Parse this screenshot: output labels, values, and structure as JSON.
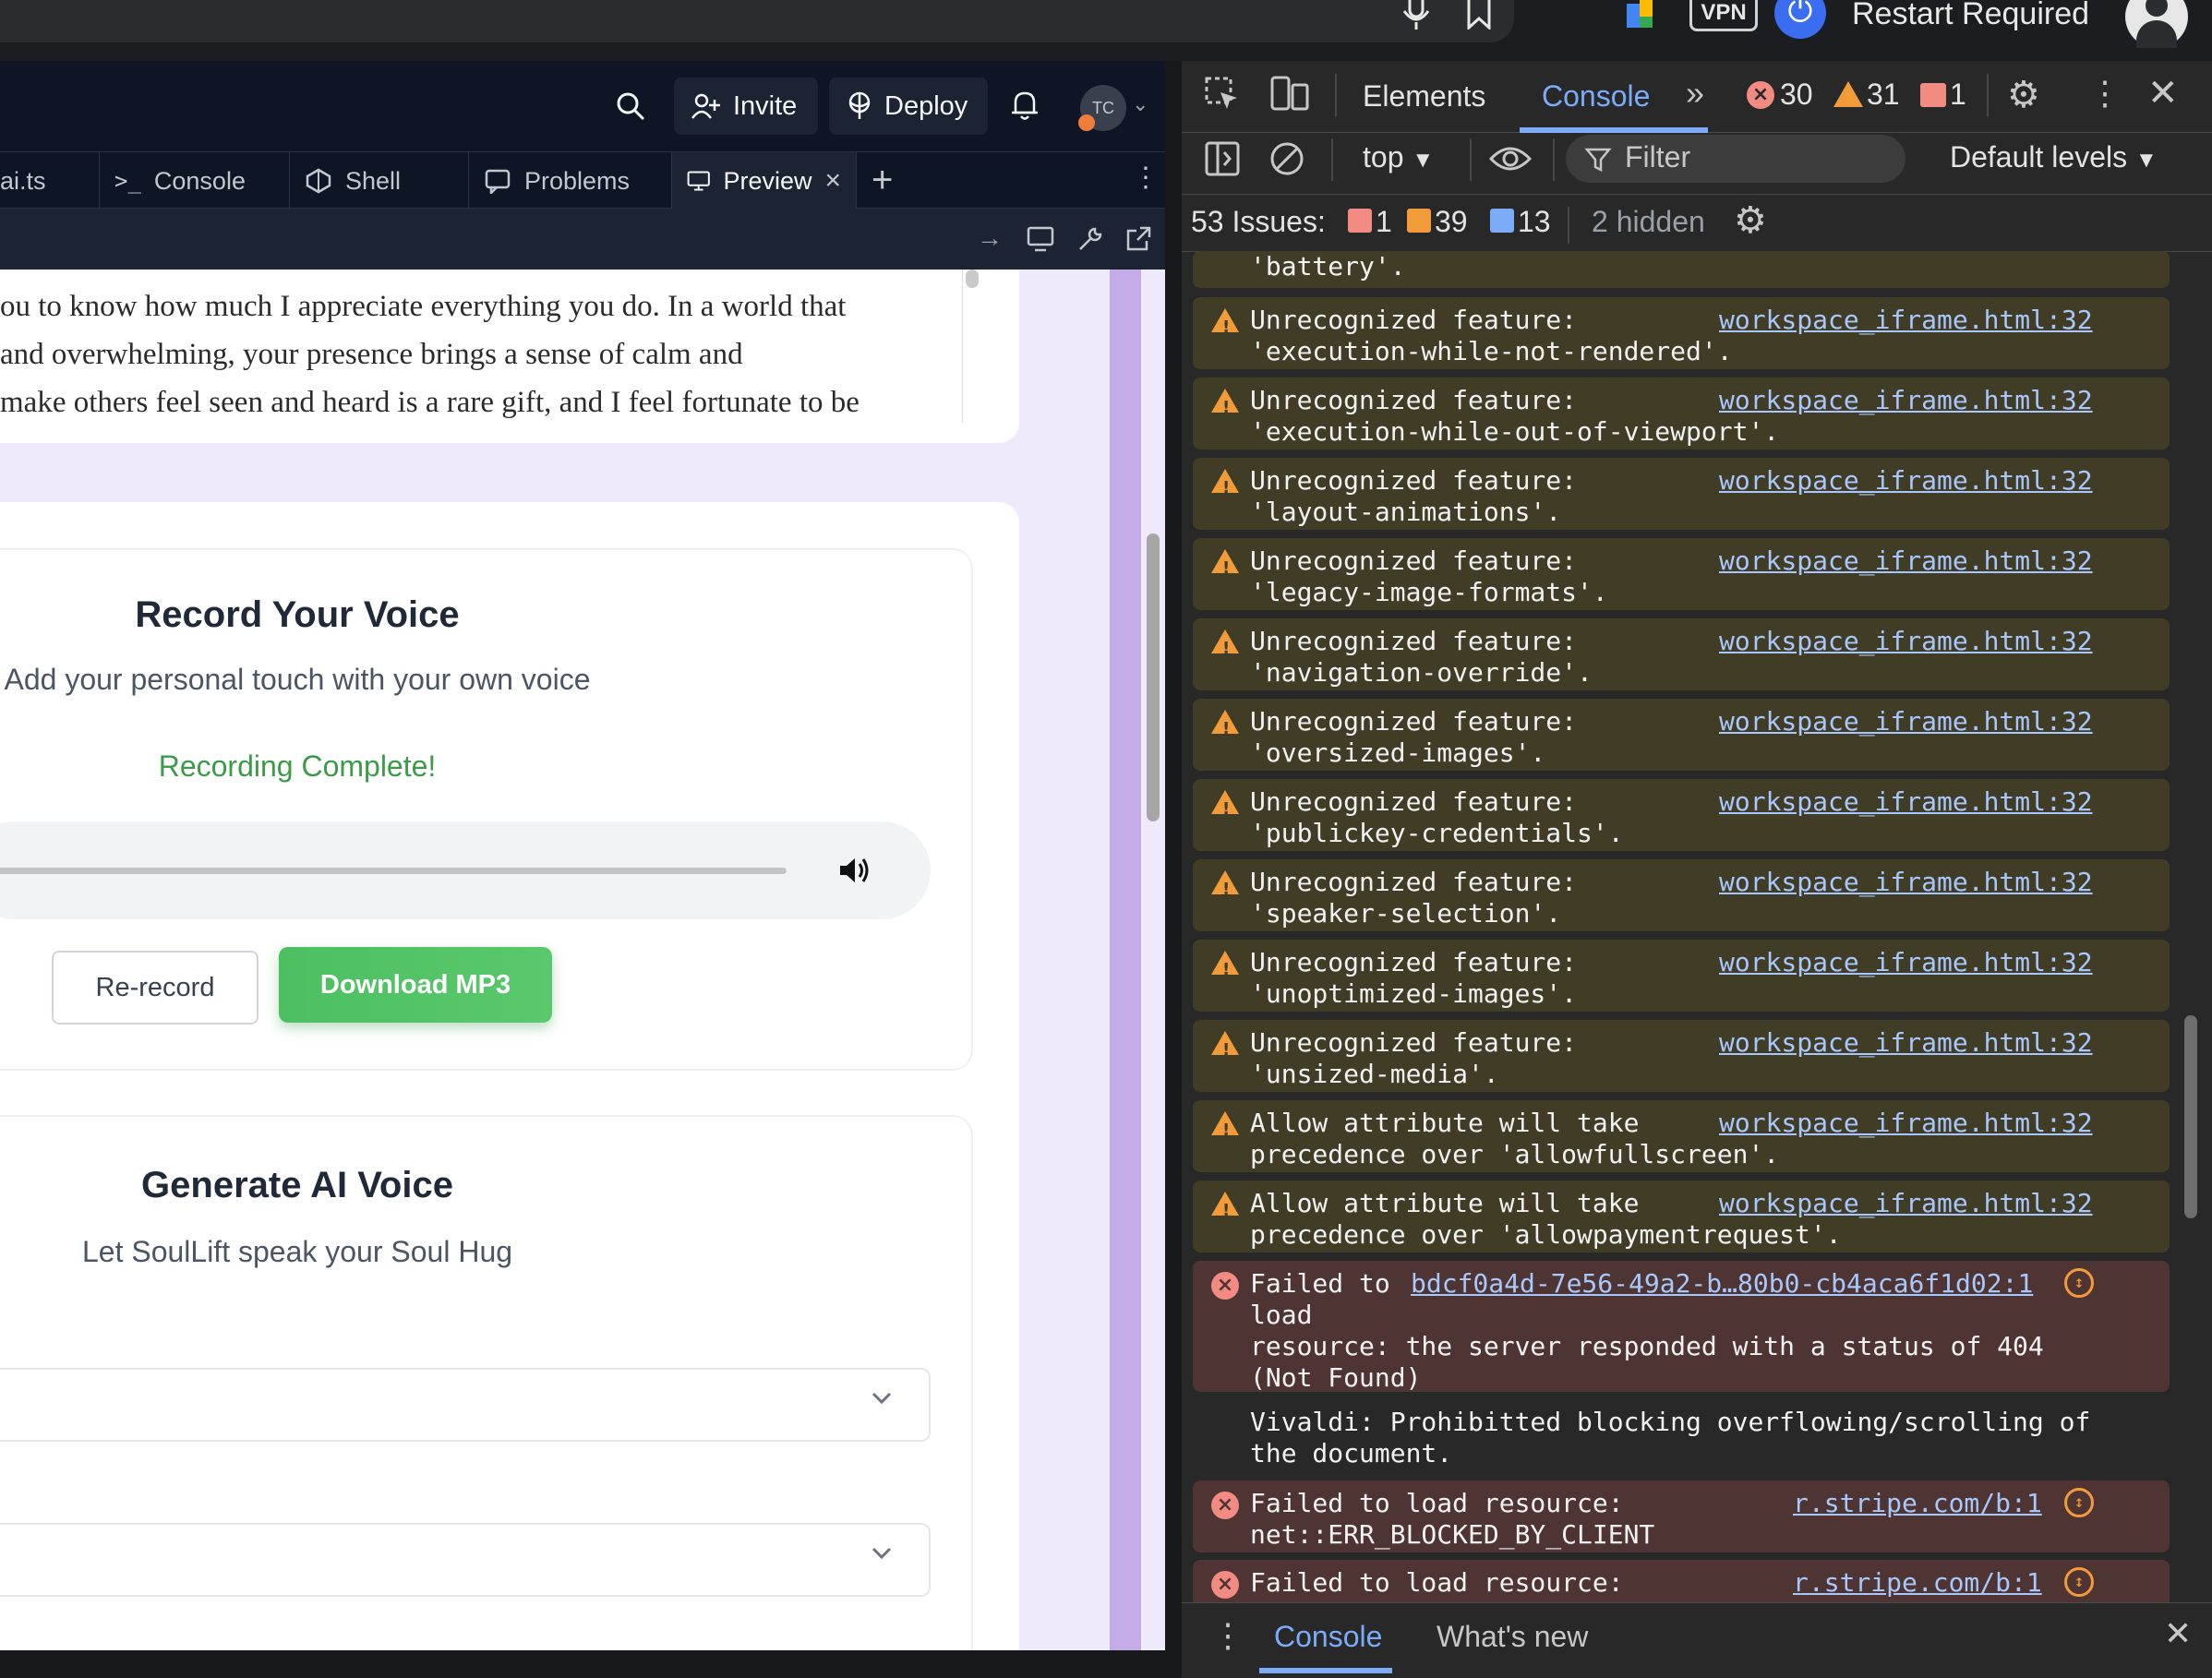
{
  "os": {
    "vpn_label": "VPN",
    "restart_label": "Restart Required"
  },
  "replit": {
    "header": {
      "invite_label": "Invite",
      "deploy_label": "Deploy",
      "avatar_initials": "TC"
    },
    "tabs": [
      {
        "label": "ai.ts"
      },
      {
        "label": "Console"
      },
      {
        "label": "Shell"
      },
      {
        "label": "Problems"
      },
      {
        "label": "Preview"
      }
    ],
    "tab_close": "×",
    "tab_add": "+",
    "preview": {
      "letter_lines": [
        "ou to know how much I appreciate everything you do. In a world that",
        "and overwhelming, your presence brings a sense of calm and",
        "make others feel seen and heard is a rare gift, and I feel fortunate to be"
      ],
      "record": {
        "title": "Record Your Voice",
        "subtitle": "Add your personal touch with your own voice",
        "status": "Recording Complete!",
        "rerecord_label": "Re-record",
        "download_label": "Download MP3"
      },
      "generate": {
        "title": "Generate AI Voice",
        "subtitle": "Let SoulLift speak your Soul Hug"
      }
    }
  },
  "devtools": {
    "tabs": {
      "elements": "Elements",
      "console": "Console"
    },
    "counts": {
      "errors": "30",
      "warnings": "31",
      "issues": "1"
    },
    "toolbar": {
      "context": "top",
      "filter_placeholder": "Filter",
      "levels": "Default levels"
    },
    "issues_bar": {
      "label": "53 Issues:",
      "err": "1",
      "warn": "39",
      "info": "13",
      "hidden": "2 hidden"
    },
    "messages": {
      "m0_line2": "'battery'.",
      "m1_line1": "Unrecognized feature:",
      "m1_line2": "'execution-while-not-rendered'.",
      "m2_line1": "Unrecognized feature:",
      "m2_line2": "'execution-while-out-of-viewport'.",
      "m3_line1": "Unrecognized feature:",
      "m3_line2": "'layout-animations'.",
      "m4_line1": "Unrecognized feature:",
      "m4_line2": "'legacy-image-formats'.",
      "m5_line1": "Unrecognized feature:",
      "m5_line2": "'navigation-override'.",
      "m6_line1": "Unrecognized feature:",
      "m6_line2": "'oversized-images'.",
      "m7_line1": "Unrecognized feature:",
      "m7_line2": "'publickey-credentials'.",
      "m8_line1": "Unrecognized feature:",
      "m8_line2": "'speaker-selection'.",
      "m9_line1": "Unrecognized feature:",
      "m9_line2": "'unoptimized-images'.",
      "m10_line1": "Unrecognized feature:",
      "m10_line2": "'unsized-media'.",
      "m11_line1": "Allow attribute will take",
      "m11_line2": "precedence over 'allowfullscreen'.",
      "m12_line1": "Allow attribute will take",
      "m12_line2": "precedence over 'allowpaymentrequest'.",
      "source": "workspace_iframe.html:32",
      "e1_line1": "Failed to",
      "e1_line2": "load",
      "e1_line3": "resource: the server responded with a status of 404",
      "e1_line4": "(Not Found)",
      "e1_source": "bdcf0a4d-7e56-49a2-b…80b0-cb4aca6f1d02:1",
      "v_line1": "Vivaldi: Prohibitted blocking overflowing/scrolling of",
      "v_line2": "the document.",
      "e2_line1": "Failed to load resource:",
      "e2_line2": "net::ERR_BLOCKED_BY_CLIENT",
      "e2_source": "r.stripe.com/b:1",
      "e3_line1": "Failed to load resource:",
      "e3_source": "r.stripe.com/b:1"
    },
    "drawer": {
      "console": "Console",
      "whats_new": "What's new"
    }
  }
}
